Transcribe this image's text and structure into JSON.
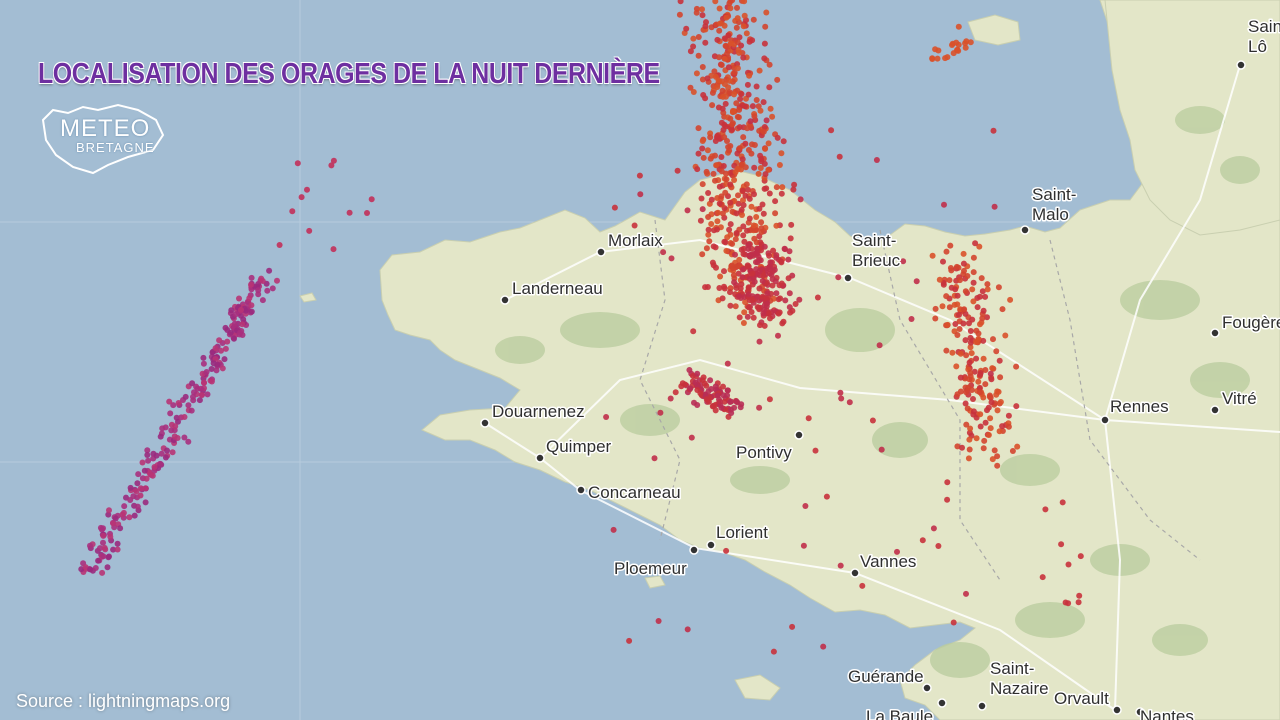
{
  "title": "LOCALISATION DES ORAGES DE LA NUIT DERNIÈRE",
  "logo": {
    "line1": "METEO",
    "line2": "BRETAGNE"
  },
  "source": "Source : lightningmaps.org",
  "colors": {
    "sea": "#a3bdd3",
    "land": "#e3e6c8",
    "forest": "#b9cc9e",
    "title": "#6e2fa0",
    "strike_purple": "#9a2a7e",
    "strike_red": "#c8323c",
    "strike_orange": "#d9512a"
  },
  "cities": [
    {
      "name": "Saint-Lô",
      "lines": [
        "Saint-",
        "Lô"
      ]
    },
    {
      "name": "Saint-Malo",
      "lines": [
        "Saint-",
        "Malo"
      ]
    },
    {
      "name": "Morlaix",
      "lines": [
        "Morlaix"
      ]
    },
    {
      "name": "Saint-Brieuc",
      "lines": [
        "Saint-",
        "Brieuc"
      ]
    },
    {
      "name": "Landerneau",
      "lines": [
        "Landerneau"
      ]
    },
    {
      "name": "Fougères",
      "lines": [
        "Fougère"
      ]
    },
    {
      "name": "Douarnenez",
      "lines": [
        "Douarnenez"
      ]
    },
    {
      "name": "Rennes",
      "lines": [
        "Rennes"
      ]
    },
    {
      "name": "Vitré",
      "lines": [
        "Vitré"
      ]
    },
    {
      "name": "Quimper",
      "lines": [
        "Quimper"
      ]
    },
    {
      "name": "Pontivy",
      "lines": [
        "Pontivy"
      ]
    },
    {
      "name": "Concarneau",
      "lines": [
        "Concarneau"
      ]
    },
    {
      "name": "Lorient",
      "lines": [
        "Lorient"
      ]
    },
    {
      "name": "Ploemeur",
      "lines": [
        "Ploemeur"
      ]
    },
    {
      "name": "Vannes",
      "lines": [
        "Vannes"
      ]
    },
    {
      "name": "Guérande",
      "lines": [
        "Guérande"
      ]
    },
    {
      "name": "Saint-Nazaire",
      "lines": [
        "Saint-",
        "Nazaire"
      ]
    },
    {
      "name": "Orvault",
      "lines": [
        "Orvault"
      ]
    },
    {
      "name": "Nantes",
      "lines": [
        "Nantes"
      ]
    },
    {
      "name": "La Baule",
      "lines": [
        "La Baule"
      ]
    }
  ]
}
